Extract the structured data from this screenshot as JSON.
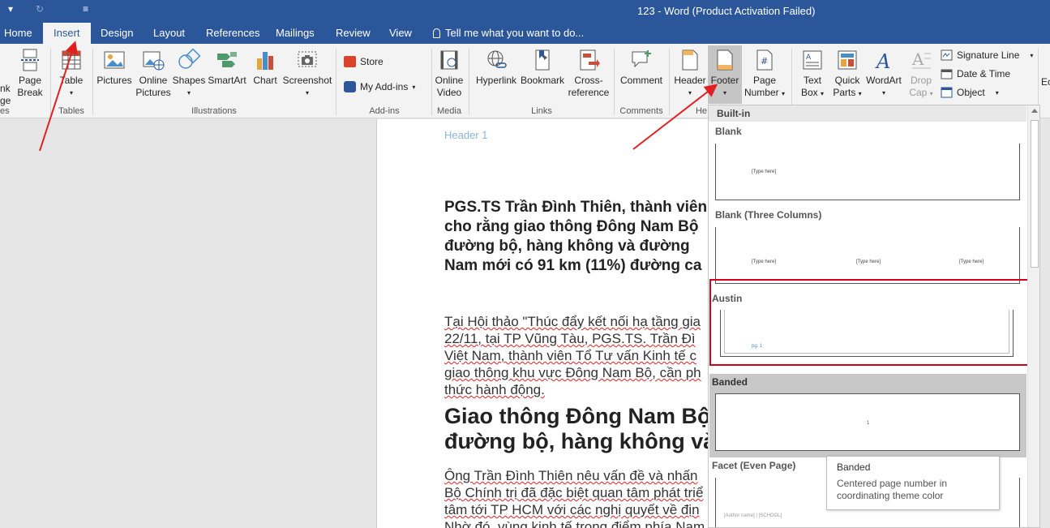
{
  "titlebar": {
    "title": "123 - Word (Product Activation Failed)",
    "undo_symbol": "↺",
    "redo_symbol": "↻",
    "qat_more": "▾",
    "qat_customize": "≡"
  },
  "tabs": [
    {
      "label": "Home"
    },
    {
      "label": "Insert"
    },
    {
      "label": "Design"
    },
    {
      "label": "Layout"
    },
    {
      "label": "References"
    },
    {
      "label": "Mailings"
    },
    {
      "label": "Review"
    },
    {
      "label": "View"
    }
  ],
  "tellme": {
    "placeholder": "Tell me what you want to do..."
  },
  "ribbon": {
    "pages_partial": [
      "nk",
      "ge"
    ],
    "pages_group_partial": "es",
    "page_break": [
      "Page",
      "Break"
    ],
    "table": "Table",
    "tables_group": "Tables",
    "pictures": "Pictures",
    "online_pictures": [
      "Online",
      "Pictures"
    ],
    "shapes": "Shapes",
    "smartart": "SmartArt",
    "chart": "Chart",
    "screenshot": "Screenshot",
    "illustrations_group": "Illustrations",
    "store": "Store",
    "my_addins": "My Add-ins",
    "addins_group": "Add-ins",
    "online_video": [
      "Online",
      "Video"
    ],
    "media_group": "Media",
    "hyperlink": "Hyperlink",
    "bookmark": "Bookmark",
    "cross_reference": [
      "Cross-",
      "reference"
    ],
    "links_group": "Links",
    "comment": "Comment",
    "comments_group": "Comments",
    "header": "Header",
    "footer": "Footer",
    "page_number": [
      "Page",
      "Number"
    ],
    "header_group_partial": "He",
    "text_box": [
      "Text",
      "Box"
    ],
    "quick_parts": [
      "Quick",
      "Parts"
    ],
    "wordart": "WordArt",
    "drop_cap": [
      "Drop",
      "Cap"
    ],
    "signature_line": "Signature Line",
    "date_time": "Date & Time",
    "object": "Object",
    "edge_partial": "Ec"
  },
  "document": {
    "header_text": "Header 1",
    "bold_lines": [
      "PGS.TS Trần Đình Thiên, thành viên",
      "cho rằng giao thông Đông Nam Bộ",
      "đường bộ, hàng không và đường",
      "Nam mới có 91 km (11%) đường ca"
    ],
    "para1": [
      "Tại Hội thảo \"Thúc đẩy kết nối hạ tầng gia",
      "22/11, tại TP Vũng Tàu, PGS.TS. Trần Đì",
      "Việt Nam, thành viên Tổ Tư vấn Kinh tế c",
      "giao thông khu vực Đông Nam Bộ, cần ph",
      "thức hành động."
    ],
    "heading": [
      "Giao thông Đông Nam Bộ",
      "đường bộ, hàng không và"
    ],
    "para2": [
      "Ông Trần Đình Thiên nêu vấn đề và nhấn",
      "Bộ Chính trị đã đặc biệt quan tâm phát triể",
      "tâm tới TP HCM với các nghị quyết về địn",
      "Nhờ đó, vùng kinh tế trọng điểm phía Nam"
    ]
  },
  "gallery": {
    "section": "Built-in",
    "items": [
      {
        "name": "Blank",
        "placeholders": [
          "[Type here]"
        ]
      },
      {
        "name": "Blank (Three Columns)",
        "placeholders": [
          "[Type here]",
          "[Type here]",
          "[Type here]"
        ]
      },
      {
        "name": "Austin",
        "placeholders": [
          "pg. 1"
        ]
      },
      {
        "name": "Banded",
        "placeholders": [
          "1"
        ]
      },
      {
        "name": "Facet (Even Page)",
        "placeholders": [
          "[Author name] | [SCHOOL]"
        ]
      }
    ]
  },
  "tooltip": {
    "title": "Banded",
    "description": "Centered page number in coordinating theme color"
  },
  "colors": {
    "accent": "#2b579a",
    "highlight_red": "#d0021b",
    "header_text": "#8bb4d8"
  }
}
